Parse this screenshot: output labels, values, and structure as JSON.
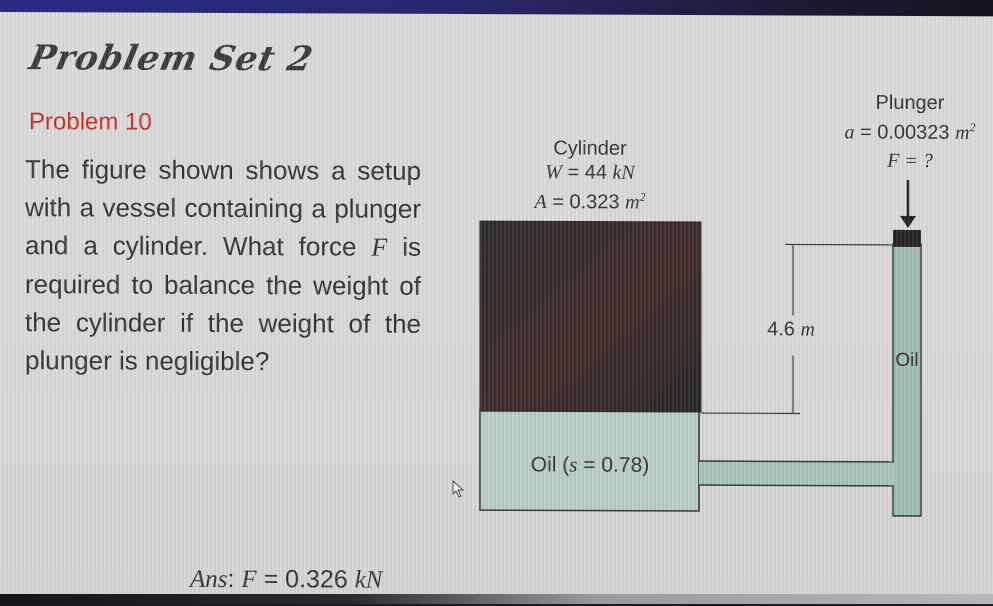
{
  "slide": {
    "title": "Problem Set 2",
    "problem_number": "Problem 10",
    "question": {
      "part1": "The figure shown shows a setup with a vessel containing a plunger and a cylinder. What force ",
      "var": "F",
      "part2": " is required to balance the weight of the cylinder if the weight of the plunger is negligible?"
    },
    "answer": {
      "prefix": "Ans",
      "colon": ": ",
      "var": "F",
      "eq": " = 0.326 ",
      "unit": "kN"
    }
  },
  "diagram": {
    "cylinder": {
      "title": "Cylinder",
      "weight_var": "W",
      "weight_eq": " = 44 ",
      "weight_unit": "kN",
      "area_var": "A",
      "area_eq": " = 0.323 ",
      "area_unit": "m",
      "area_exp": "2"
    },
    "plunger": {
      "title": "Plunger",
      "area_var": "a",
      "area_eq": " = 0.00323 ",
      "area_unit": "m",
      "area_exp": "2",
      "force_label": "F = ?"
    },
    "height": {
      "value": "4.6 ",
      "unit": "m"
    },
    "oil_main_label": {
      "text": "Oil (",
      "var": "s",
      "eq": " = 0.78)"
    },
    "oil_tube_label": "Oil",
    "colors": {
      "cylinder": "#2e2626",
      "oil": "#b7ccc4",
      "oil_tube": "#9dbdb1",
      "plunger": "#232323",
      "title_red": "#c0302c"
    }
  }
}
